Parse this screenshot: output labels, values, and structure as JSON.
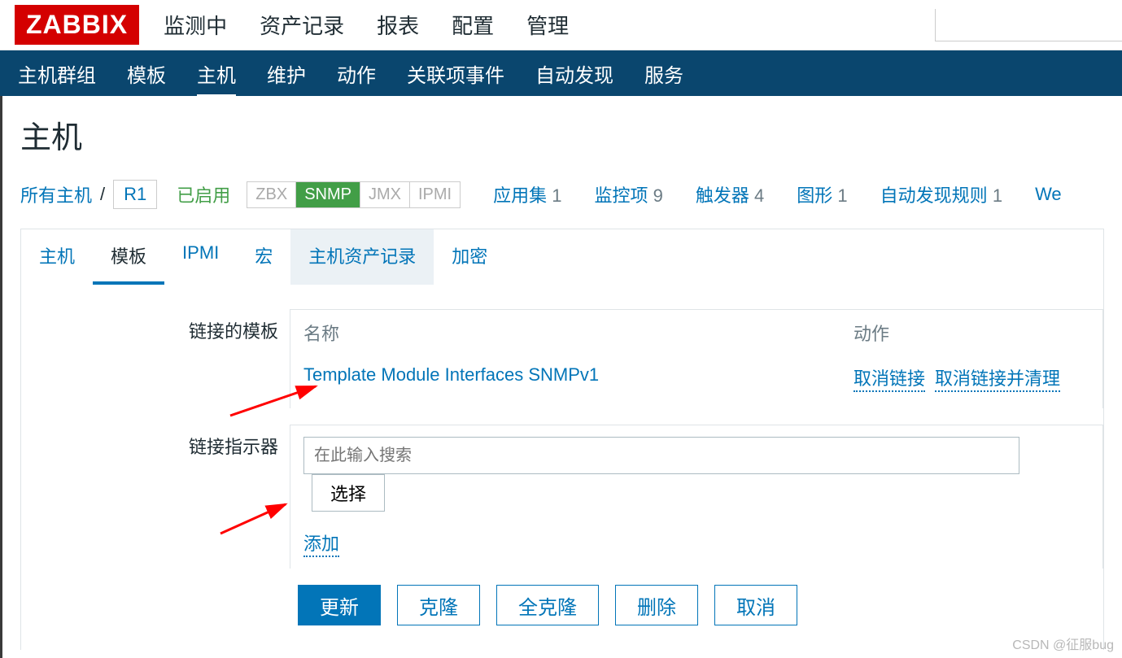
{
  "logo": "ZABBIX",
  "topnav": [
    "监测中",
    "资产记录",
    "报表",
    "配置",
    "管理"
  ],
  "topnav_active": 3,
  "subnav": [
    "主机群组",
    "模板",
    "主机",
    "维护",
    "动作",
    "关联项事件",
    "自动发现",
    "服务"
  ],
  "subnav_active": 2,
  "page_title": "主机",
  "breadcrumb": {
    "all_hosts": "所有主机",
    "sep": "/",
    "host": "R1"
  },
  "status_enabled": "已启用",
  "protocols": {
    "zbx": "ZBX",
    "snmp": "SNMP",
    "jmx": "JMX",
    "ipmi": "IPMI"
  },
  "stats": [
    {
      "label": "应用集",
      "count": "1"
    },
    {
      "label": "监控项",
      "count": "9"
    },
    {
      "label": "触发器",
      "count": "4"
    },
    {
      "label": "图形",
      "count": "1"
    },
    {
      "label": "自动发现规则",
      "count": "1"
    },
    {
      "label": "We"
    }
  ],
  "tabs": [
    "主机",
    "模板",
    "IPMI",
    "宏",
    "主机资产记录",
    "加密"
  ],
  "tabs_active": 1,
  "tabs_hover": 4,
  "form": {
    "linked_templates_label": "链接的模板",
    "tmpl_head_name": "名称",
    "tmpl_head_action": "动作",
    "tmpl_name": "Template Module Interfaces SNMPv1",
    "action_unlink": "取消链接",
    "action_unlink_clear": "取消链接并清理",
    "link_indicator_label": "链接指示器",
    "search_placeholder": "在此输入搜索",
    "select_btn": "选择",
    "add_link": "添加"
  },
  "buttons": {
    "update": "更新",
    "clone": "克隆",
    "full_clone": "全克隆",
    "delete": "删除",
    "cancel": "取消"
  },
  "watermark": "CSDN @征服bug"
}
